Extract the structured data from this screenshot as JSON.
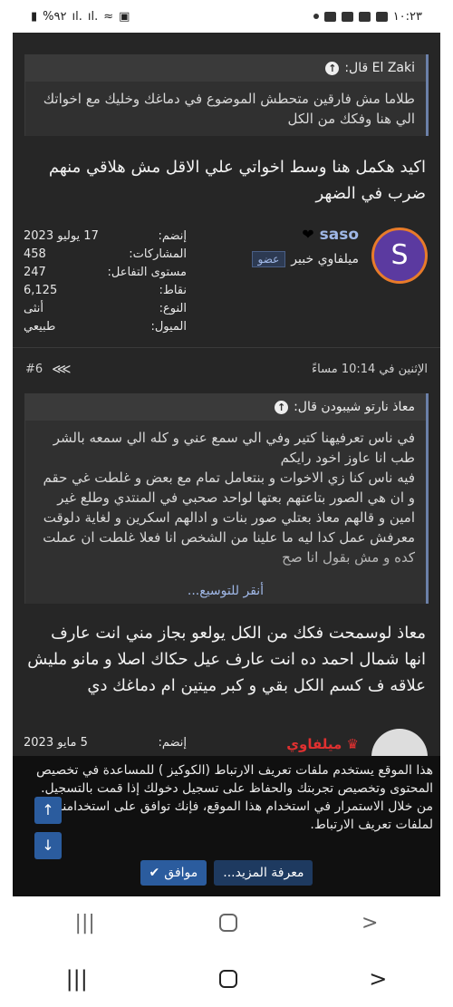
{
  "status_bar": {
    "time": "١٠:٢٣",
    "battery": "%٩٢"
  },
  "quote1": {
    "author": "El Zaki قال:",
    "text": "طلاما مش فارقين متحطش الموضوع في دماغك وخليك مع اخواتك الي هنا وفكك من الكل"
  },
  "post1_text": "اكيد هكمل هنا وسط اخواتي علي الاقل مش هلاقي منهم ضرب في الضهر",
  "user": {
    "avatar_letter": "S",
    "name": "saso",
    "heart": "❤",
    "title": "ميلفاوي خبير",
    "badge": "عضو",
    "stats": [
      {
        "label": "إنضم:",
        "value": "17 يوليو 2023"
      },
      {
        "label": "المشاركات:",
        "value": "458"
      },
      {
        "label": "مستوى التفاعل:",
        "value": "247"
      },
      {
        "label": "نقاط:",
        "value": "6,125"
      },
      {
        "label": "النوع:",
        "value": "أنثى"
      },
      {
        "label": "الميول:",
        "value": "طبيعي"
      }
    ]
  },
  "post_meta": {
    "date": "الإثنين في 10:14 مساءً",
    "number": "#6"
  },
  "quote2": {
    "author": "معاذ نارتو شيبودن قال:",
    "lines": [
      "في ناس تعرفيهنا كتير وفي الي سمع عني و كله الي سمعه بالشر طب انا عاوز اخود رايكم",
      "فيه ناس كنا زي الاخوات و بنتعامل تمام مع بعض و غلطت غي حقم و ان هي الصور بتاعتهم بعتها لواحد صحبي في المنتدي وطلع غير امين و قالهم معاذ بعتلي صور بنات و ادالهم اسكرين و لغاية دلوقت معرفش عمل كدا ليه ما علينا من الشخص انا فعلا غلطت ان عملت كده و مش بقول انا صح"
    ],
    "expand": "أنقر للتوسيع..."
  },
  "post2_text": "معاذ لوسمحت فكك من الكل يولعو بجاز مني انت عارف انها شمال احمد ده انت عارف عيل حكاك اصلا و مانو مليش علاقه ف كسم الكل بقي و كبر ميتين ام دماغك دي",
  "next_user": {
    "name": "ميلفاوي",
    "joined_label": "إنضم:",
    "joined_value": "5 مايو 2023"
  },
  "cookie": {
    "text": "هذا الموقع يستخدم ملفات تعريف الارتباط (الكوكيز ) للمساعدة في تخصيص المحتوى وتخصيص تجربتك والحفاظ على تسجيل دخولك إذا قمت بالتسجيل.",
    "text2": "من خلال الاستمرار في استخدام هذا الموقع، فإنك توافق على استخدامنا لملفات تعريف الارتباط.",
    "accept": "موافق",
    "learn_more": "معرفة المزيد..."
  }
}
